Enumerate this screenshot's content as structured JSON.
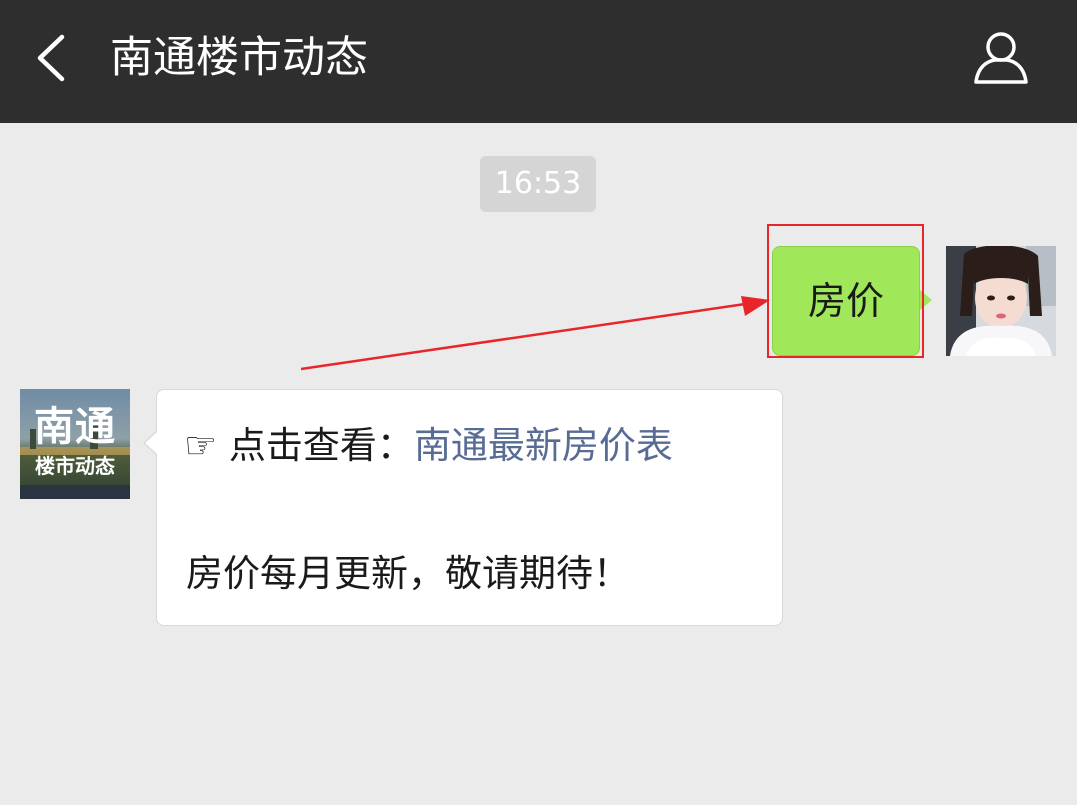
{
  "header": {
    "title": "南通楼市动态",
    "back_icon": "chevron-left-icon",
    "profile_icon": "person-icon"
  },
  "chat": {
    "timestamp": "16:53",
    "sent_message": {
      "text": "房价",
      "bubble_color": "#a0e75a"
    },
    "received_message": {
      "prefix": "☞ 点击查看：",
      "link_text": "南通最新房价表",
      "link_color": "#576b95",
      "body": "房价每月更新，敬请期待！"
    },
    "bot_avatar": {
      "line1": "南通",
      "line2": "楼市动态"
    }
  },
  "annotation": {
    "color": "#e8262a"
  }
}
